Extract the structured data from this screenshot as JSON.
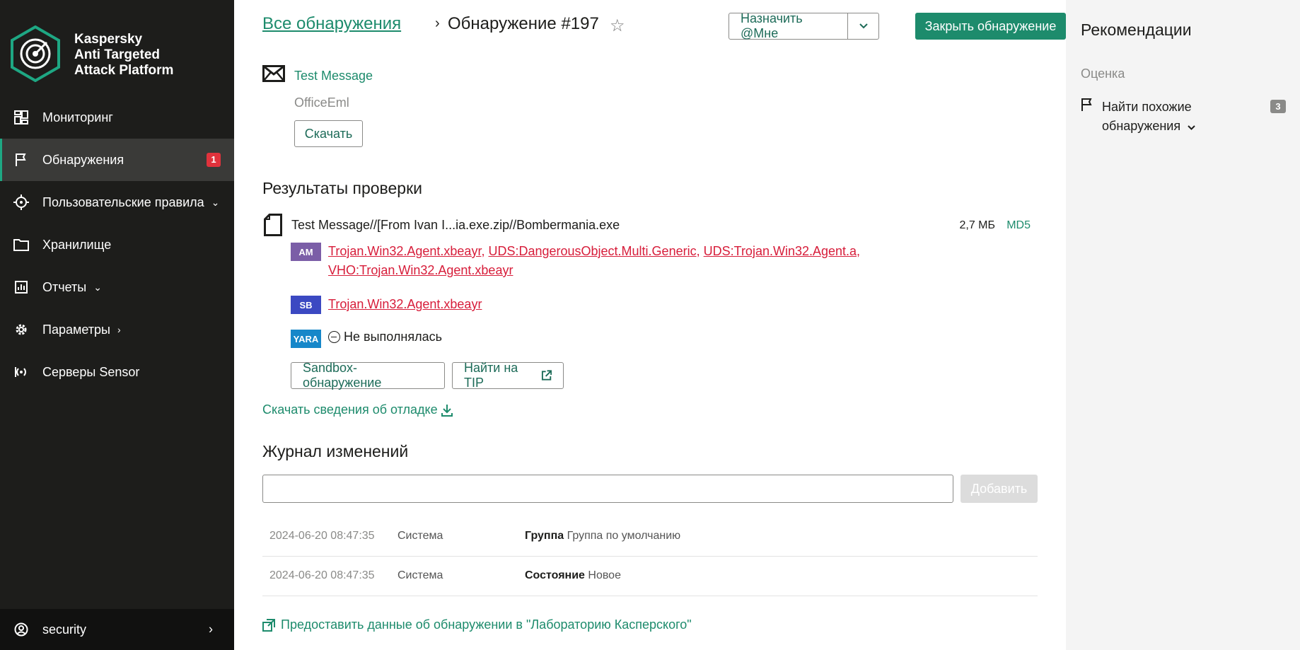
{
  "brand": {
    "line1": "Kaspersky",
    "line2": "Anti Targeted",
    "line3": "Attack Platform"
  },
  "nav": {
    "items": [
      {
        "label": "Мониторинг",
        "icon": "dashboard-icon"
      },
      {
        "label": "Обнаружения",
        "icon": "flag-icon",
        "badge": "1",
        "active": true
      },
      {
        "label": "Пользовательские правила",
        "icon": "crosshair-icon",
        "chevron": "down"
      },
      {
        "label": "Хранилище",
        "icon": "folder-icon"
      },
      {
        "label": "Отчеты",
        "icon": "report-icon",
        "chevron": "down"
      },
      {
        "label": "Параметры",
        "icon": "gear-icon",
        "chevron": "right"
      },
      {
        "label": "Серверы Sensor",
        "icon": "sensor-icon"
      }
    ],
    "user": "security"
  },
  "header": {
    "breadcrumb_link": "Все обнаружения",
    "breadcrumb_sep": "›",
    "title": "Обнаружение #197",
    "assign_button": "Назначить @Мне",
    "close_button": "Закрыть обнаружение"
  },
  "message": {
    "name": "Test Message",
    "type": "OfficeEml",
    "download_button": "Скачать"
  },
  "scan": {
    "title": "Результаты проверки",
    "file": {
      "name": "Test Message//[From Ivan I...ia.exe.zip//Bombermania.exe",
      "size": "2,7 МБ",
      "hash_label": "MD5"
    },
    "engines": {
      "am": {
        "label": "AM",
        "threats": [
          "Trojan.Win32.Agent.xbeayr",
          "UDS:DangerousObject.Multi.Generic",
          "UDS:Trojan.Win32.Agent.a",
          "VHO:Trojan.Win32.Agent.xbeayr"
        ]
      },
      "sb": {
        "label": "SB",
        "threats": [
          "Trojan.Win32.Agent.xbeayr"
        ]
      },
      "yara": {
        "label": "YARA",
        "status": "Не выполнялась"
      }
    },
    "sandbox_button": "Sandbox-обнаружение",
    "tip_button": "Найти на TIP",
    "debug_link": "Скачать сведения об отладке"
  },
  "log": {
    "title": "Журнал изменений",
    "input_value": "",
    "add_button": "Добавить",
    "rows": [
      {
        "date": "2024-06-20 08:47:35",
        "user": "Система",
        "field": "Группа",
        "value": "Группа по умолчанию"
      },
      {
        "date": "2024-06-20 08:47:35",
        "user": "Система",
        "field": "Состояние",
        "value": "Новое"
      }
    ]
  },
  "share_link": "Предоставить данные об обнаружении в \"Лабораторию Касперского\"",
  "recommendations": {
    "title": "Рекомендации",
    "subtitle": "Оценка",
    "item_label": "Найти похожие обнаружения",
    "item_count": "3"
  },
  "colors": {
    "accent": "#1d8b6c",
    "sidebar_bg": "#1d1d1b",
    "threat_red": "#d71d3a",
    "badge_red": "#e0323c",
    "am_purple": "#7b5ea7",
    "sb_blue": "#3b49c2",
    "yara_blue": "#1787c9"
  }
}
